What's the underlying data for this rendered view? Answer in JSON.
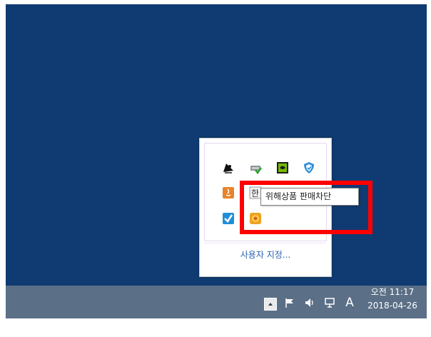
{
  "tray_popup": {
    "tooltip_text": "위해상품 판매차단",
    "customize_label": "사용자 지정...",
    "icons": [
      "satellite-dish-icon",
      "network-adapter-icon",
      "nvidia-icon",
      "security-shield-icon",
      "java-icon",
      "hangul-ime-icon",
      "pink-app-icon",
      "blue-app-icon",
      "checkbox-app-icon",
      "orange-sun-app-icon"
    ]
  },
  "taskbar": {
    "ime_mode": "A",
    "clock": {
      "period_time": "오전 11:17",
      "date": "2018-04-26"
    }
  },
  "colors": {
    "desktop": "#0f3b72",
    "taskbar": "#5b6f87",
    "highlight": "#ff0000",
    "link": "#2a62b3"
  }
}
